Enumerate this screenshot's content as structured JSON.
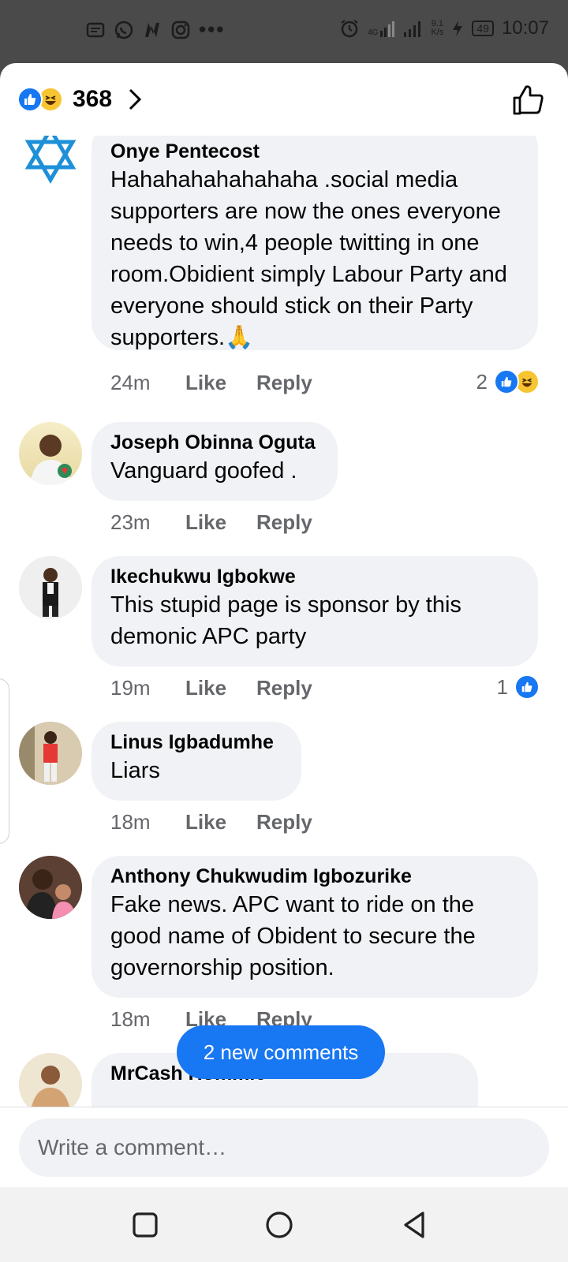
{
  "status_bar": {
    "time": "10:07",
    "network_gen": "4G",
    "net_speed_value": "9.1",
    "net_speed_unit": "K/s",
    "battery": "49",
    "more_notifications": "•••"
  },
  "reactions": {
    "count": "368",
    "types": [
      "like",
      "haha"
    ]
  },
  "comments": [
    {
      "author": "Onye Pentecost",
      "text": "Hahahahahahahaha .social media supporters are now the ones everyone needs to win,4 people twitting in one room.Obidient simply Labour Party and everyone should stick on their Party supporters.🙏",
      "time": "24m",
      "like_label": "Like",
      "reply_label": "Reply",
      "reaction_count": "2",
      "reaction_types": [
        "like",
        "haha"
      ]
    },
    {
      "author": "Joseph Obinna Oguta",
      "text": "Vanguard goofed .",
      "time": "23m",
      "like_label": "Like",
      "reply_label": "Reply"
    },
    {
      "author": "Ikechukwu Igbokwe",
      "text": "This stupid page is sponsor by this demonic APC party",
      "time": "19m",
      "like_label": "Like",
      "reply_label": "Reply",
      "reaction_count": "1",
      "reaction_types": [
        "like"
      ]
    },
    {
      "author": "Linus Igbadumhe",
      "text": "Liars",
      "time": "18m",
      "like_label": "Like",
      "reply_label": "Reply"
    },
    {
      "author": "Anthony Chukwudim Igbozurike",
      "text": "Fake news. APC want to ride on the good name of Obident to secure the governorship position.",
      "time": "18m",
      "like_label": "Like",
      "reply_label": "Reply"
    },
    {
      "author": "MrCash Hommie"
    }
  ],
  "new_comments_label": "2 new comments",
  "composer": {
    "placeholder": "Write a comment…"
  },
  "colors": {
    "accent": "#1877f2",
    "bubble": "#f0f2f5",
    "muted_text": "#65676b"
  }
}
